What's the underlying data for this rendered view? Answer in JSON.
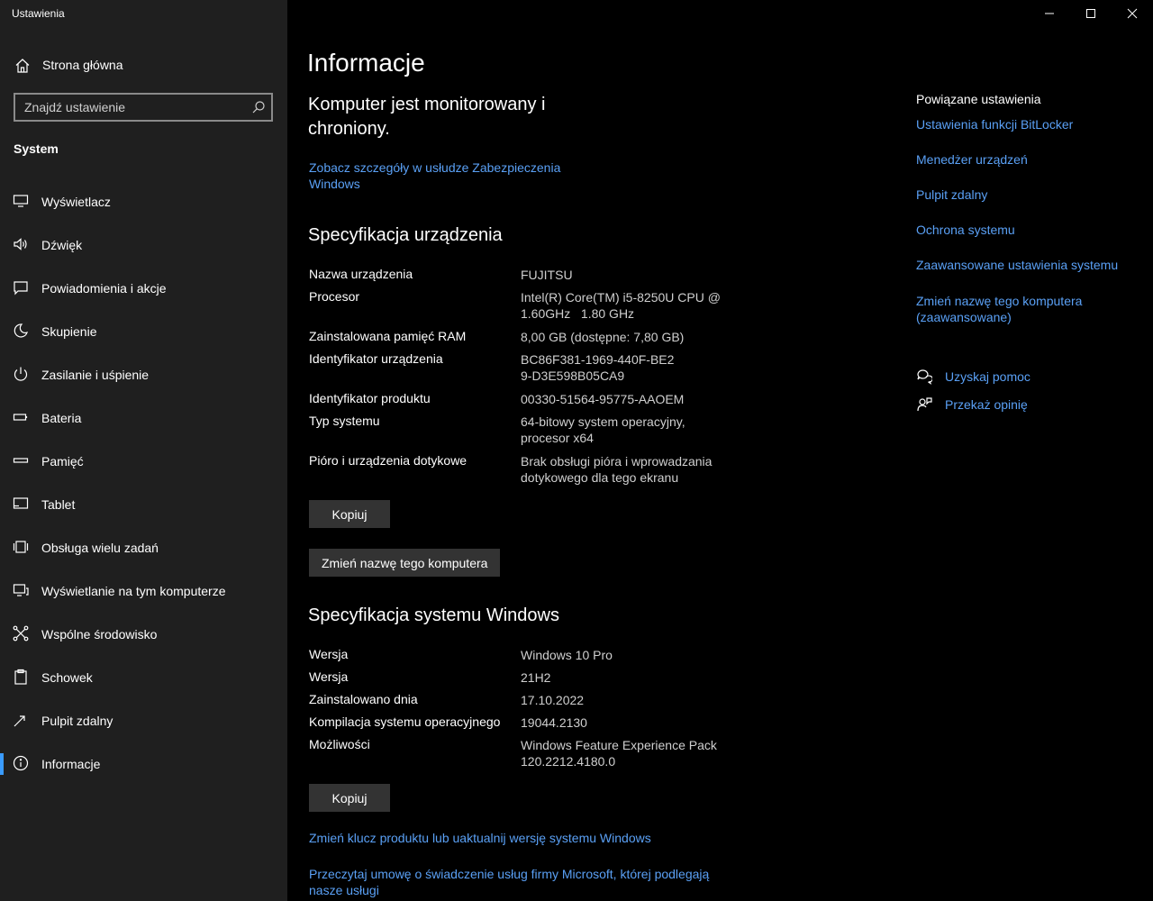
{
  "app": {
    "title": "Ustawienia"
  },
  "sidebar": {
    "home_label": "Strona główna",
    "search_placeholder": "Znajdź ustawienie",
    "section_label": "System",
    "items": [
      {
        "label": "Wyświetlacz",
        "icon": "monitor-icon"
      },
      {
        "label": "Dźwięk",
        "icon": "speaker-icon"
      },
      {
        "label": "Powiadomienia i akcje",
        "icon": "notification-icon"
      },
      {
        "label": "Skupienie",
        "icon": "moon-icon"
      },
      {
        "label": "Zasilanie i uśpienie",
        "icon": "power-icon"
      },
      {
        "label": "Bateria",
        "icon": "battery-icon"
      },
      {
        "label": "Pamięć",
        "icon": "storage-icon"
      },
      {
        "label": "Tablet",
        "icon": "tablet-icon"
      },
      {
        "label": "Obsługa wielu zadań",
        "icon": "multitasking-icon"
      },
      {
        "label": "Wyświetlanie na tym komputerze",
        "icon": "projecting-icon"
      },
      {
        "label": "Wspólne środowisko",
        "icon": "shared-experience-icon"
      },
      {
        "label": "Schowek",
        "icon": "clipboard-icon"
      },
      {
        "label": "Pulpit zdalny",
        "icon": "remote-desktop-icon"
      },
      {
        "label": "Informacje",
        "icon": "info-icon",
        "active": true
      }
    ]
  },
  "main": {
    "title": "Informacje",
    "monitor_text": "Komputer jest monitorowany i chroniony.",
    "security_link": "Zobacz szczegóły w usłudze Zabezpieczenia Windows",
    "device_spec": {
      "heading": "Specyfikacja urządzenia",
      "rows": [
        {
          "key": "Nazwa urządzenia",
          "value": "FUJITSU"
        },
        {
          "key": "Procesor",
          "value": "Intel(R) Core(TM) i5-8250U CPU @ 1.60GHz   1.80 GHz"
        },
        {
          "key": "Zainstalowana pamięć RAM",
          "value": "8,00 GB (dostępne: 7,80 GB)"
        },
        {
          "key": "Identyfikator urządzenia",
          "value": "BC86F381-1969-440F-BE29-D3E598B05CA9"
        },
        {
          "key": "Identyfikator produktu",
          "value": "00330-51564-95775-AAOEM"
        },
        {
          "key": "Typ systemu",
          "value": "64-bitowy system operacyjny, procesor x64"
        },
        {
          "key": "Pióro i urządzenia dotykowe",
          "value": "Brak obsługi pióra i wprowadzania dotykowego dla tego ekranu"
        }
      ],
      "copy_button": "Kopiuj",
      "rename_button": "Zmień nazwę tego komputera"
    },
    "windows_spec": {
      "heading": "Specyfikacja systemu Windows",
      "rows": [
        {
          "key": "Wersja",
          "value": "Windows 10 Pro"
        },
        {
          "key": "Wersja",
          "value": "21H2"
        },
        {
          "key": "Zainstalowano dnia",
          "value": "17.10.2022"
        },
        {
          "key": "Kompilacja systemu operacyjnego",
          "value": "19044.2130"
        },
        {
          "key": "Możliwości",
          "value": "Windows Feature Experience Pack 120.2212.4180.0"
        }
      ],
      "copy_button": "Kopiuj"
    },
    "link_change_key": "Zmień klucz produktu lub uaktualnij wersję systemu Windows",
    "link_agreement": "Przeczytaj umowę o świadczenie usług firmy Microsoft, której podlegają nasze usługi"
  },
  "related": {
    "title": "Powiązane ustawienia",
    "links": [
      "Ustawienia funkcji BitLocker",
      "Menedżer urządzeń",
      "Pulpit zdalny",
      "Ochrona systemu",
      "Zaawansowane ustawienia systemu",
      "Zmień nazwę tego komputera (zaawansowane)"
    ],
    "help_label": "Uzyskaj pomoc",
    "feedback_label": "Przekaż opinię"
  },
  "colors": {
    "accent": "#3a9bfd",
    "link": "#5aa0f5",
    "sidebar_bg": "#1f1f1f",
    "main_bg": "#000000",
    "button_bg": "#333333"
  }
}
